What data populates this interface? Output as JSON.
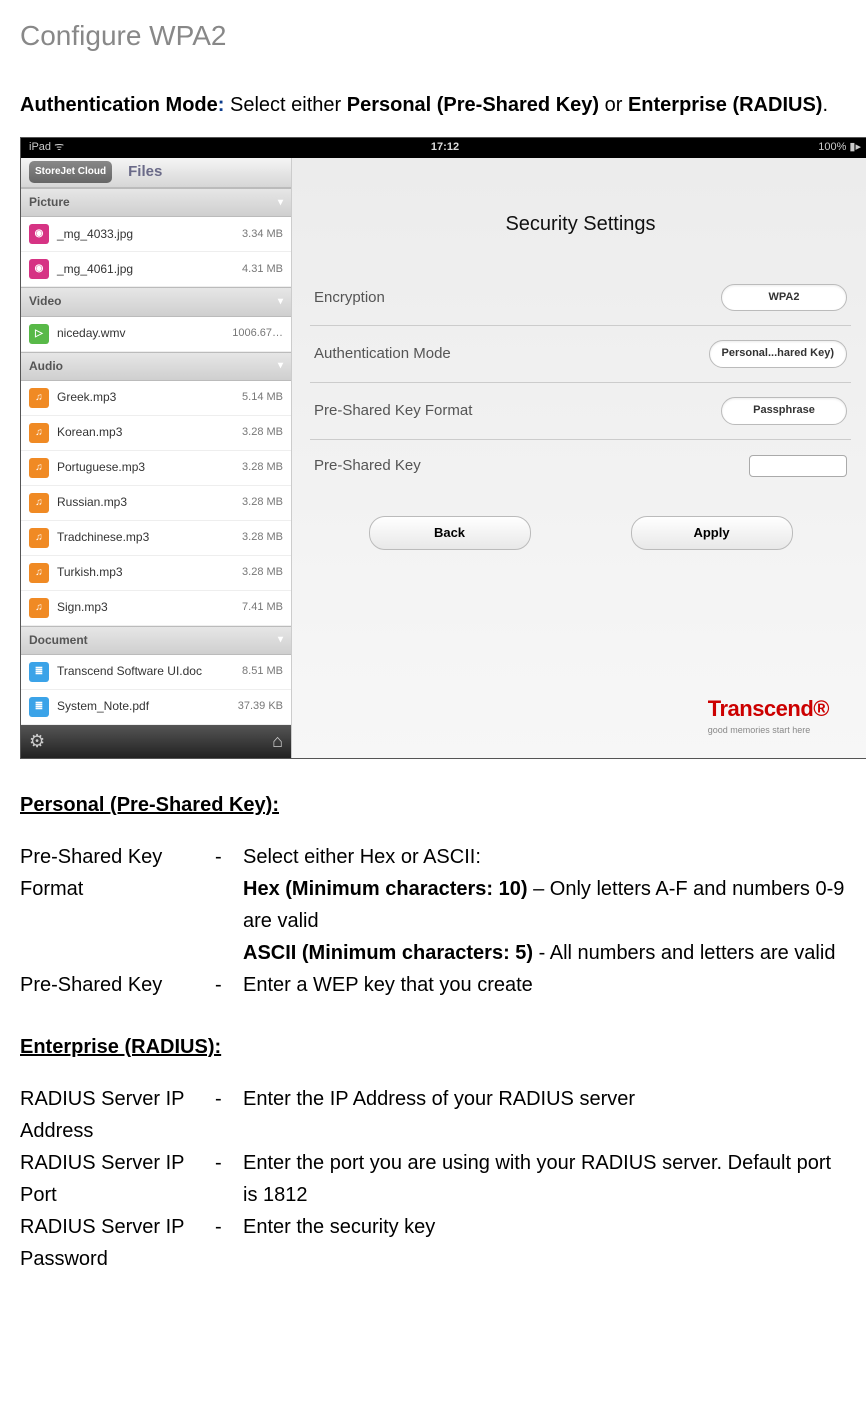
{
  "page": {
    "title": "Configure WPA2",
    "intro_prefix": "Authentication Mode",
    "intro_colon": ":",
    "intro_mid": " Select either ",
    "intro_opt1": "Personal (Pre-Shared Key)",
    "intro_or": " or ",
    "intro_opt2": "Enterprise (RADIUS)",
    "intro_end": "."
  },
  "screenshot": {
    "statusbar": {
      "left": "iPad  ᯤ",
      "center": "17:12",
      "right": "100% ▮▸"
    },
    "sidebar_header": {
      "app": "StoreJet Cloud",
      "tab": "Files"
    },
    "sections": [
      {
        "name": "Picture",
        "items": [
          {
            "icon": "ic-pink",
            "glyph": "◉",
            "name": "_mg_4033.jpg",
            "size": "3.34 MB"
          },
          {
            "icon": "ic-pink",
            "glyph": "◉",
            "name": "_mg_4061.jpg",
            "size": "4.31 MB"
          }
        ]
      },
      {
        "name": "Video",
        "items": [
          {
            "icon": "ic-green",
            "glyph": "▷",
            "name": "niceday.wmv",
            "size": "1006.67…"
          }
        ]
      },
      {
        "name": "Audio",
        "items": [
          {
            "icon": "ic-orange",
            "glyph": "♫",
            "name": "Greek.mp3",
            "size": "5.14 MB"
          },
          {
            "icon": "ic-orange",
            "glyph": "♫",
            "name": "Korean.mp3",
            "size": "3.28 MB"
          },
          {
            "icon": "ic-orange",
            "glyph": "♫",
            "name": "Portuguese.mp3",
            "size": "3.28 MB"
          },
          {
            "icon": "ic-orange",
            "glyph": "♫",
            "name": "Russian.mp3",
            "size": "3.28 MB"
          },
          {
            "icon": "ic-orange",
            "glyph": "♫",
            "name": "Tradchinese.mp3",
            "size": "3.28 MB"
          },
          {
            "icon": "ic-orange",
            "glyph": "♫",
            "name": "Turkish.mp3",
            "size": "3.28 MB"
          },
          {
            "icon": "ic-orange",
            "glyph": "♫",
            "name": "Sign.mp3",
            "size": "7.41 MB"
          }
        ]
      },
      {
        "name": "Document",
        "items": [
          {
            "icon": "ic-blue",
            "glyph": "≣",
            "name": "Transcend Software UI.doc",
            "size": "8.51 MB"
          },
          {
            "icon": "ic-blue",
            "glyph": "≣",
            "name": "System_Note.pdf",
            "size": "37.39 KB"
          }
        ]
      }
    ],
    "content_title": "Security Settings",
    "settings": [
      {
        "label": "Encryption",
        "value": "WPA2"
      },
      {
        "label": "Authentication Mode",
        "value": "Personal...hared Key)"
      },
      {
        "label": "Pre-Shared Key Format",
        "value": "Passphrase"
      },
      {
        "label": "Pre-Shared Key",
        "value": ""
      }
    ],
    "actions": {
      "back": "Back",
      "apply": "Apply"
    },
    "brand": {
      "name": "Transcend®",
      "slogan": "good memories start here"
    }
  },
  "personal": {
    "heading": "Personal (Pre-Shared Key)",
    "row1_term": "Pre-Shared Key Format",
    "row1_line1": "Select either Hex or ASCII:",
    "row1_hex_b": "Hex (Minimum characters: 10)",
    "row1_hex_t": " – Only letters A-F and numbers 0-9 are valid",
    "row1_asc_b": "ASCII (Minimum characters: 5)",
    "row1_asc_t": " - All numbers and letters are valid",
    "row2_term": "Pre-Shared Key",
    "row2_desc": "Enter a WEP key that you create"
  },
  "enterprise": {
    "heading": "Enterprise (RADIUS)",
    "r1_term": "RADIUS Server IP Address",
    "r1_desc": "Enter the IP Address of your RADIUS server",
    "r2_term": "RADIUS Server IP Port",
    "r2_desc": "Enter the port you are using with your RADIUS server. Default port is 1812",
    "r3_term": "RADIUS Server IP Password",
    "r3_desc": "Enter the security key"
  },
  "dash": "-"
}
